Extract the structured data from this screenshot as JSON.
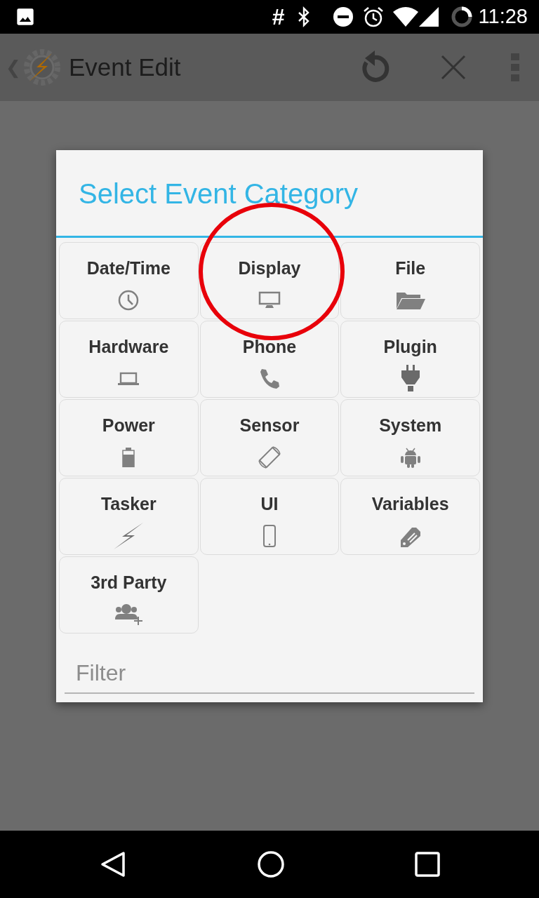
{
  "status_bar": {
    "time": "11:28",
    "hash": "#"
  },
  "app_bar": {
    "back": "❮",
    "title": "Event Edit"
  },
  "dialog": {
    "title": "Select Event Category",
    "categories": [
      {
        "label": "Date/Time",
        "circled": false
      },
      {
        "label": "Display",
        "circled": true
      },
      {
        "label": "File",
        "circled": false
      },
      {
        "label": "Hardware",
        "circled": false
      },
      {
        "label": "Phone",
        "circled": false
      },
      {
        "label": "Plugin",
        "circled": false
      },
      {
        "label": "Power",
        "circled": false
      },
      {
        "label": "Sensor",
        "circled": false
      },
      {
        "label": "System",
        "circled": false
      },
      {
        "label": "Tasker",
        "circled": false
      },
      {
        "label": "UI",
        "circled": false
      },
      {
        "label": "Variables",
        "circled": false
      },
      {
        "label": "3rd Party",
        "circled": false
      }
    ],
    "filter": {
      "placeholder": "Filter"
    }
  }
}
